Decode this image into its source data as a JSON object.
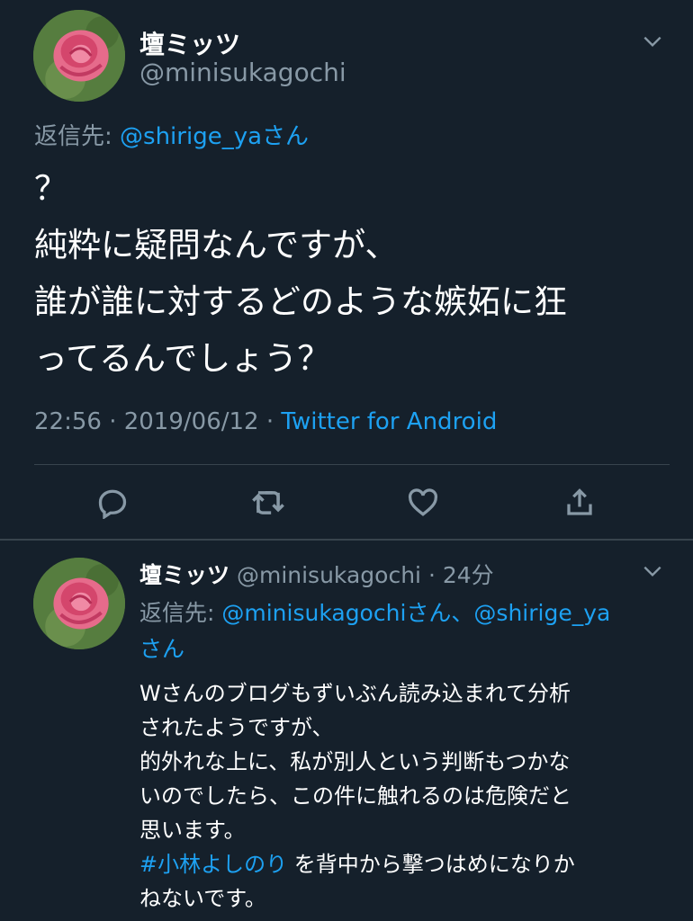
{
  "main_tweet": {
    "display_name": "壇ミッツ",
    "handle": "@minisukagochi",
    "reply_prefix": "返信先: ",
    "reply_to": "@shirige_ya",
    "reply_suffix": "さん",
    "text_lines": [
      "？",
      "純粋に疑問なんですが、",
      "誰が誰に対するどのような嫉妬に狂",
      "ってるんでしょう？"
    ],
    "timestamp": "22:56 · 2019/06/12 · ",
    "source": "Twitter for Android"
  },
  "actions": {
    "reply_icon": "reply-icon",
    "retweet_icon": "retweet-icon",
    "like_icon": "heart-icon",
    "share_icon": "share-icon"
  },
  "reply_tweet": {
    "display_name": "壇ミッツ",
    "handle": "@minisukagochi",
    "time": " · 24分",
    "reply_prefix": "返信先: ",
    "reply_to_1": "@minisukagochi",
    "reply_sep": "さん、",
    "reply_to_2": "@shirige_ya",
    "reply_suffix": "さん",
    "text_lines": [
      "Wさんのブログもずいぶん読み込まれて分析",
      "されたようですが、",
      "的外れな上に、私が別人という判断もつかな",
      "いのでしたら、この件に触れるのは危険だと",
      "思います。"
    ],
    "hashtag": "#小林よしのり",
    "after_hashtag": " を背中から撃つはめになりか",
    "last_line": "ねないです。"
  },
  "colors": {
    "background": "#15202b",
    "accent": "#1da1f2",
    "muted": "#8899a6",
    "divider": "#38444d"
  }
}
